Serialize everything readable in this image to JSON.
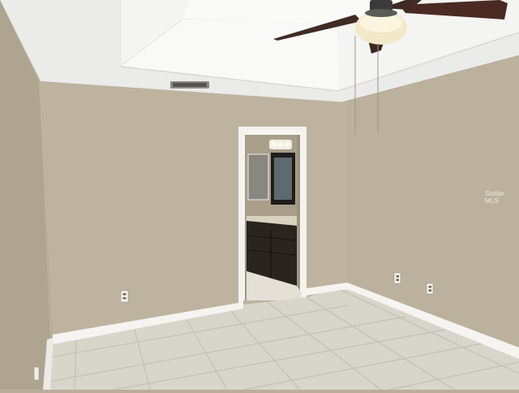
{
  "scene": {
    "description_type": "photo",
    "colors": {
      "wall": "#bdb39f",
      "wall_shadow": "#a99f8c",
      "ceiling": "#ededec",
      "tray": "#f7f7f6",
      "floor": "#d9d6cd",
      "grout": "#c2bdb2",
      "trim": "#f6f5f2",
      "cabinet": "#2a2420",
      "fan_blade": "#4a2a22"
    },
    "icons": [
      "ceiling-fan-icon",
      "air-vent-icon",
      "electrical-outlet-icon",
      "vanity-light-icon"
    ]
  },
  "watermark": {
    "text": "Stellar MLS"
  }
}
